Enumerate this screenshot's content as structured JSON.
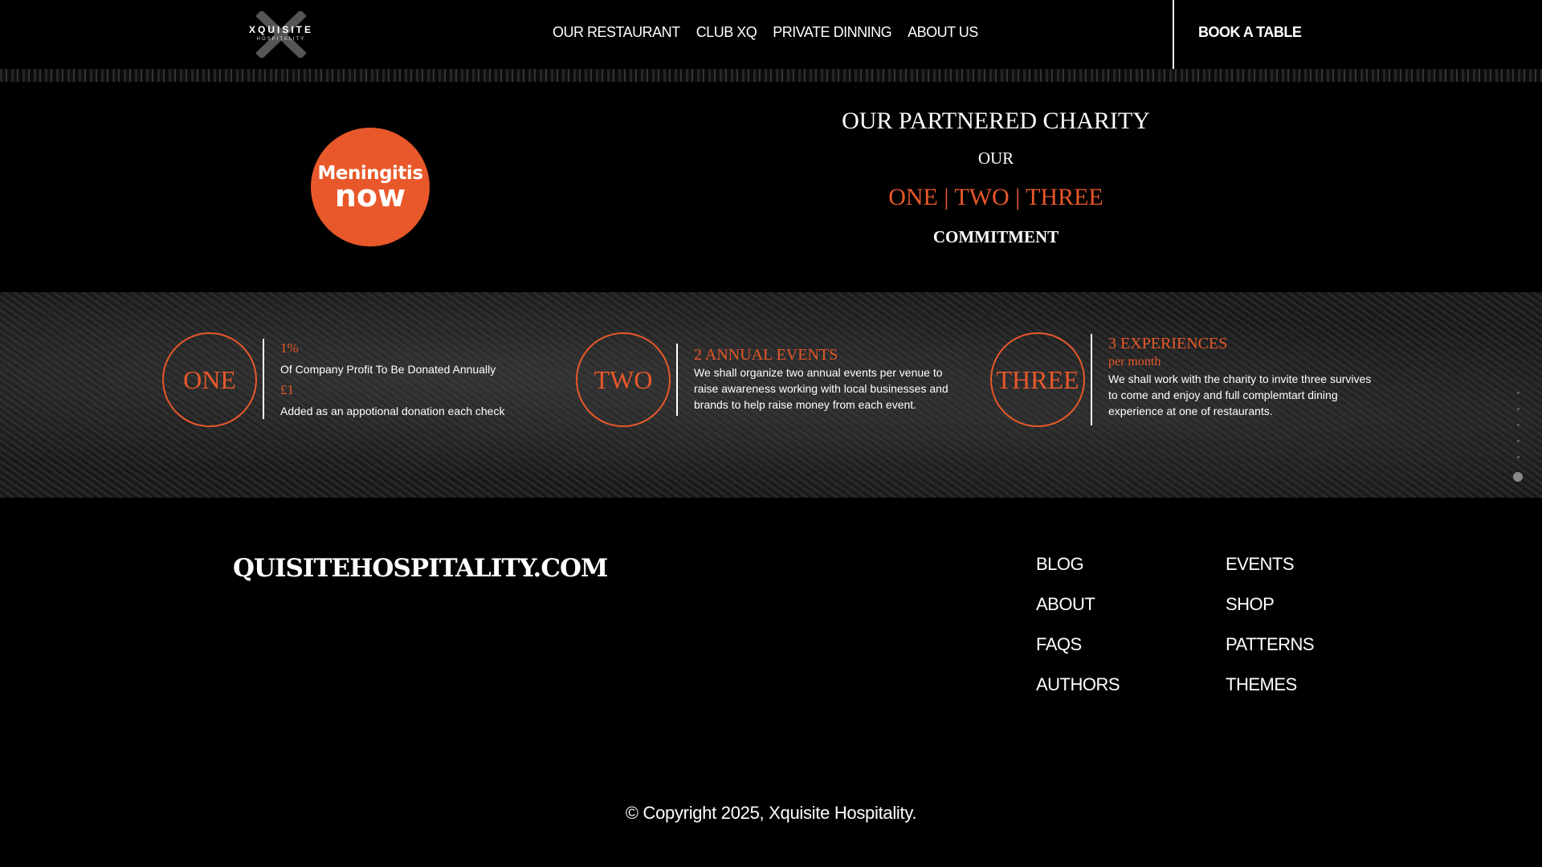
{
  "header": {
    "logo": {
      "brand": "XQUISITE",
      "sub": "HOSPITALITY"
    },
    "nav": [
      "OUR RESTAURANT",
      "CLUB XQ",
      "PRIVATE DINNING",
      "ABOUT US"
    ],
    "cta": "BOOK A TABLE"
  },
  "charity": {
    "logo_line1": "Meningitis",
    "logo_line2": "now",
    "title": "OUR PARTNERED CHARITY",
    "our": "OUR",
    "numbers": "ONE | TWO | THREE",
    "commitment": "COMMITMENT"
  },
  "commitments": [
    {
      "ring": "ONE",
      "l1": "1%",
      "l2": "Of Company Profit To Be Donated Annually",
      "l3": "£1",
      "l4": "Added as an appotional donation each check"
    },
    {
      "ring": "TWO",
      "l1": "2 ANNUAL EVENTS",
      "l2": "We shall organize two annual events per venue to",
      "l3": "raise awareness working with local businesses and",
      "l4": "brands to help raise money from each event."
    },
    {
      "ring": "THREE",
      "l1": "3 EXPERIENCES",
      "l2": "per month",
      "l3": "We shall work with the charity to invite three survives",
      "l4": "to come and enjoy and full complemtart dining",
      "l5": "experience at one of restaurants."
    }
  ],
  "footer": {
    "site": "QUISITEHOSPITALITY.COM",
    "col1": [
      "BLOG",
      "ABOUT",
      "FAQS",
      "AUTHORS"
    ],
    "col2": [
      "EVENTS",
      "SHOP",
      "PATTERNS",
      "THEMES"
    ],
    "copyright": "© Copyright 2025, Xquisite Hospitality."
  },
  "colors": {
    "accent": "#e8582a",
    "background": "#000000",
    "text": "#ffffff"
  }
}
